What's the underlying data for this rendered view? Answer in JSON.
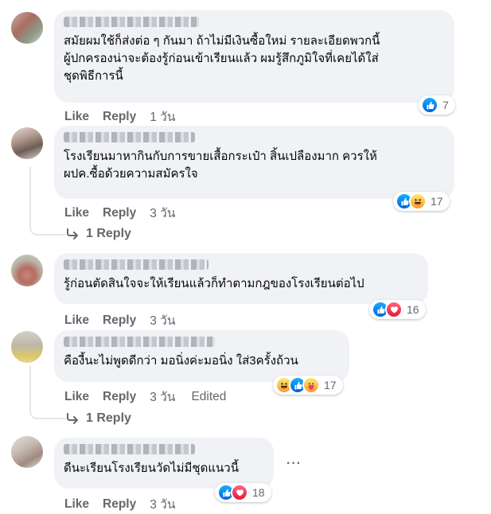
{
  "actions": {
    "like_label": "Like",
    "reply_label": "Reply",
    "edited_label": "Edited"
  },
  "reaction_types": {
    "like": "like-icon",
    "love": "love-icon",
    "haha": "haha-icon",
    "care": "care-icon"
  },
  "colors": {
    "bubble": "#f0f2f5",
    "meta_text": "#65676b",
    "like_blue": "#1877f2",
    "love_red": "#f33e58",
    "reaction_yellow": "#f7b125"
  },
  "comments": [
    {
      "lines": [
        "สมัยผมใช้ก็ส่งต่อ ๆ กันมา ถ้าไม่มีเงินซื้อใหม่ รายละเอียดพวกนี้",
        "ผู้ปกครองน่าจะต้องรู้ก่อนเข้าเรียนแล้ว ผมรู้สึกภูมิใจที่เคยได้ใส่",
        "ชุดพิธีการนี้"
      ],
      "time": "1 วัน",
      "reactions": [
        "like"
      ],
      "count": "7"
    },
    {
      "lines": [
        "โรงเรียนมาหากินกับการขายเสื้อกระเป๋า สิ้นเปลืองมาก ควรให้",
        "ผปค.ซื้อด้วยความสมัครใจ"
      ],
      "time": "3 วัน",
      "reactions": [
        "like",
        "haha"
      ],
      "count": "17",
      "replies_label": "1 Reply"
    },
    {
      "lines": [
        "รู้ก่อนตัดสินใจจะให้เรียนแล้วก็ทำตามกฎของโรงเรียนต่อไป"
      ],
      "time": "3 วัน",
      "reactions": [
        "like",
        "love"
      ],
      "count": "16"
    },
    {
      "lines": [
        "คืองี้นะไม่พูดดีกว่า มอนิ่งค่ะมอนิ่ง ใส่3ครั้งถ้วน"
      ],
      "time": "3 วัน",
      "edited": true,
      "reactions": [
        "haha",
        "like",
        "care"
      ],
      "count": "17",
      "replies_label": "1 Reply"
    },
    {
      "lines": [
        "ดีนะเรียนโรงเรียนวัดไม่มีชุดแนวนี้"
      ],
      "time": "3 วัน",
      "reactions": [
        "like",
        "love"
      ],
      "count": "18"
    }
  ]
}
